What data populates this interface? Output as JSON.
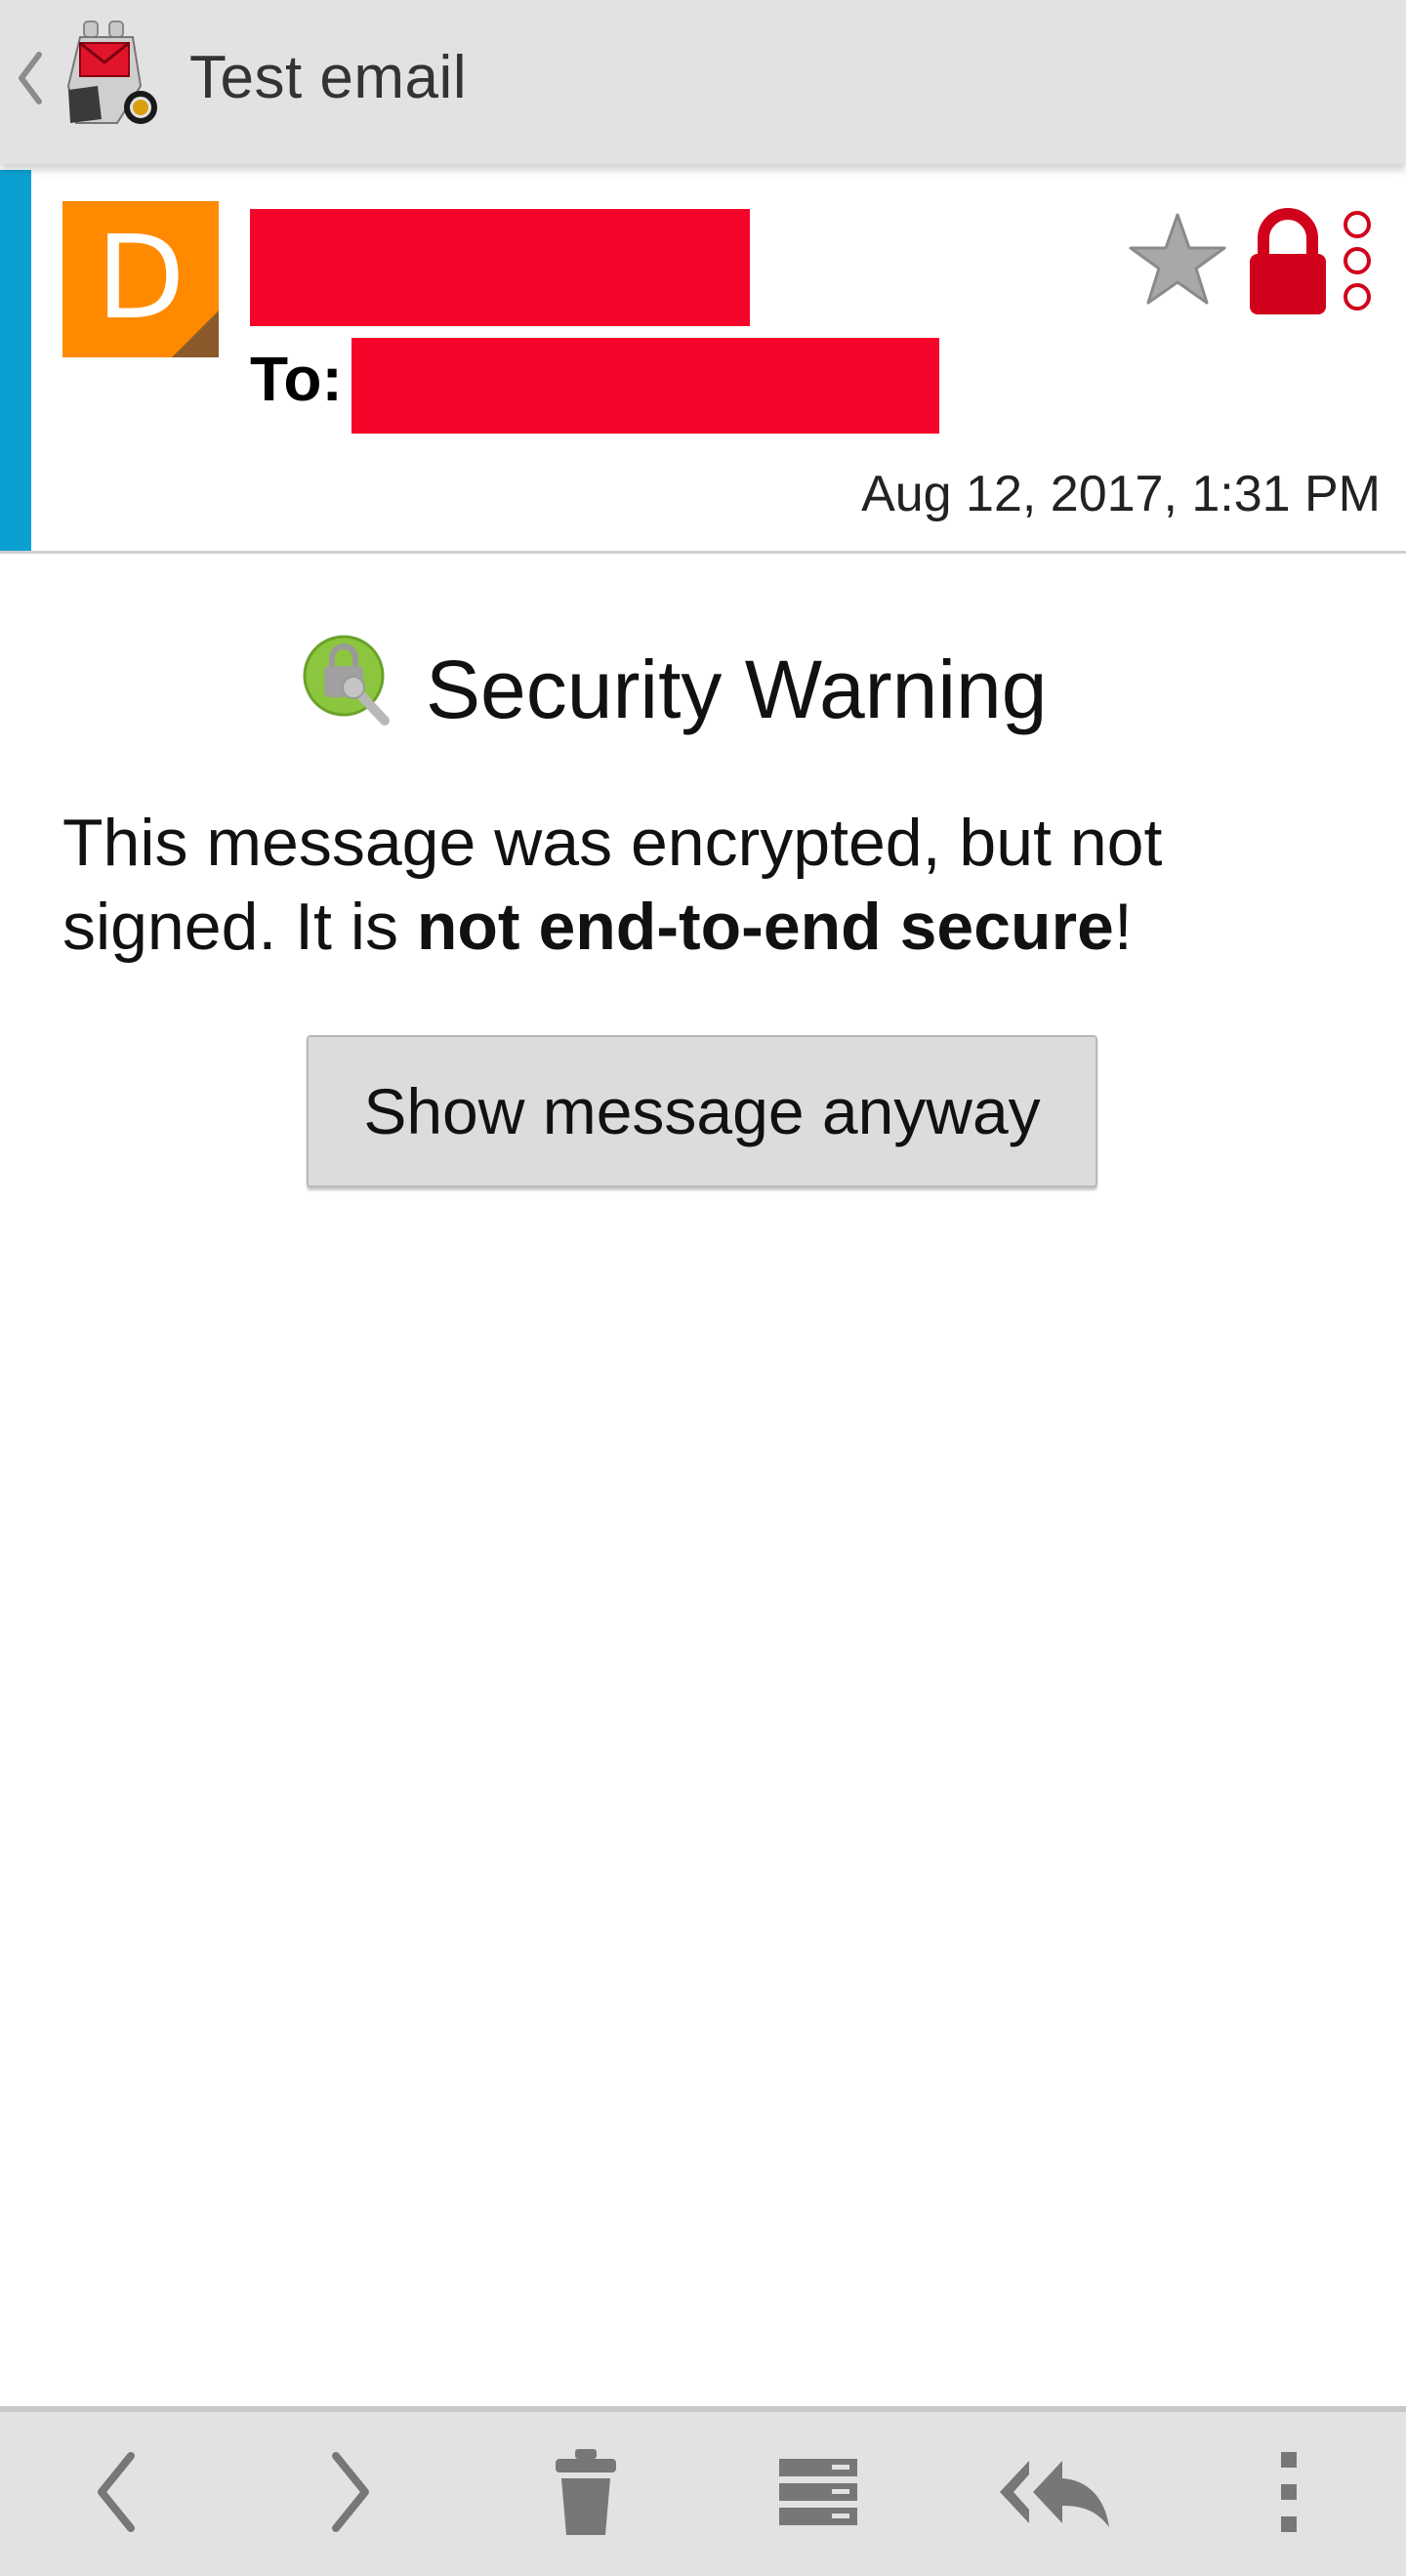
{
  "appbar": {
    "title": "Test email",
    "up_icon": "chevron-left-icon",
    "logo_icon": "k9-dog-mail-logo"
  },
  "message": {
    "avatar_letter": "D",
    "avatar_color": "#ff8a00",
    "accent_color": "#0aa0d2",
    "from_redacted_color": "#f5052a",
    "to_label": "To:",
    "date": "Aug 12, 2017, 1:31 PM",
    "icons": [
      "star-icon",
      "lock-icon",
      "overflow-menu-icon"
    ],
    "lock_color": "#d0021b"
  },
  "warning": {
    "title": "Security Warning",
    "text_part1": "This message was encrypted, but not signed. It is ",
    "text_bold": "not end-to-end secure",
    "text_part2": "!",
    "button_label": "Show message anyway"
  },
  "bottombar": {
    "buttons": [
      "previous-icon",
      "next-icon",
      "delete-icon",
      "archive-icon",
      "reply-all-icon",
      "more-icon"
    ]
  }
}
